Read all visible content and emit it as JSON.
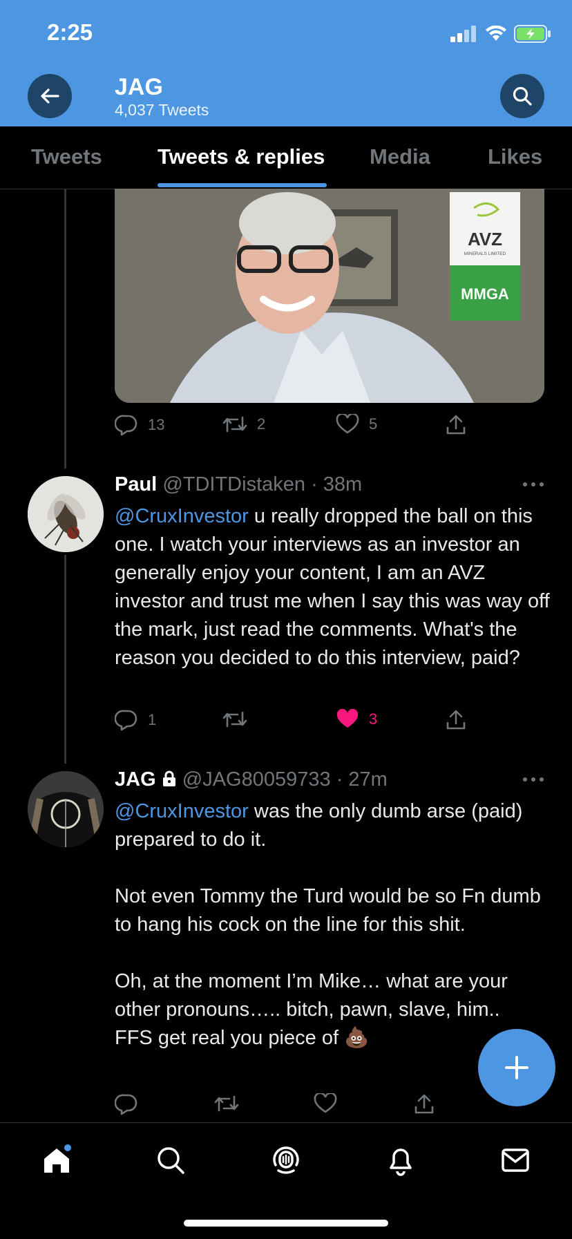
{
  "status_bar": {
    "time": "2:25"
  },
  "header": {
    "title": "JAG",
    "tweet_count": "4,037 Tweets"
  },
  "tabs": [
    {
      "label": "Tweets",
      "active": false
    },
    {
      "label": "Tweets & replies",
      "active": true
    },
    {
      "label": "Media",
      "active": false
    },
    {
      "label": "Likes",
      "active": false
    }
  ],
  "media_tweet": {
    "image_overlay": {
      "brand": "AVZ",
      "brand_sub": "MINERALS LIMITED",
      "badge": "MMGA"
    },
    "reply_count": "13",
    "retweet_count": "2",
    "like_count": "5"
  },
  "tweets": [
    {
      "name": "Paul",
      "handle": "@TDITDistaken",
      "time": "· 38m",
      "mention": "@CruxInvestor",
      "text": " u really dropped the ball on this one.  I watch your interviews as an investor an generally enjoy your content, I am an AVZ investor and trust me when I say this was way off the mark, just read the comments.  What's the reason you decided to do this interview, paid?",
      "reply_count": "1",
      "retweet_count": "",
      "like_count": "3",
      "liked": true
    },
    {
      "name": "JAG",
      "handle": "@JAG80059733",
      "time": "· 27m",
      "protected": true,
      "mention": "@CruxInvestor",
      "text": " was the only dumb arse (paid) prepared to do it.\n\nNot even Tommy the Turd would be so Fn dumb to hang his cock on the line for this shit.\n\nOh, at the moment I’m Mike… what are your other pronouns….. bitch, pawn, slave, him..   FFS get real you piece of 💩",
      "reply_count": "",
      "retweet_count": "",
      "like_count": ""
    }
  ],
  "colors": {
    "accent": "#4d96e2",
    "like": "#f91880",
    "background": "#000000",
    "muted": "#71767b"
  },
  "icons": [
    "back-arrow-icon",
    "search-icon",
    "more-icon",
    "reply-icon",
    "retweet-icon",
    "heart-icon",
    "share-icon",
    "lock-icon",
    "plus-icon",
    "home-icon",
    "explore-icon",
    "spaces-icon",
    "bell-icon",
    "mail-icon"
  ]
}
